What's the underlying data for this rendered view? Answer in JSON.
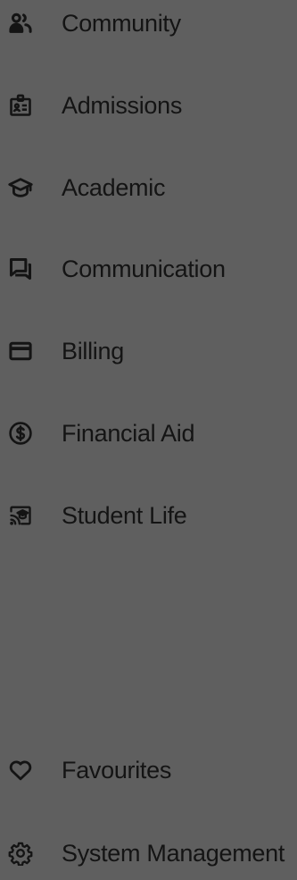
{
  "sidebar": {
    "items": [
      {
        "label": "Community",
        "icon": "community-icon"
      },
      {
        "label": "Admissions",
        "icon": "admissions-badge-icon"
      },
      {
        "label": "Academic",
        "icon": "graduation-cap-icon"
      },
      {
        "label": "Communication",
        "icon": "chat-bubbles-icon"
      },
      {
        "label": "Billing",
        "icon": "credit-card-icon"
      },
      {
        "label": "Financial Aid",
        "icon": "dollar-circle-icon"
      },
      {
        "label": "Student Life",
        "icon": "cast-graduation-icon"
      }
    ],
    "bottom_items": [
      {
        "label": "Favourites",
        "icon": "heart-icon"
      },
      {
        "label": "System Management",
        "icon": "gear-icon"
      }
    ]
  },
  "colors": {
    "background": "#5f5f5f",
    "text": "#141414"
  }
}
